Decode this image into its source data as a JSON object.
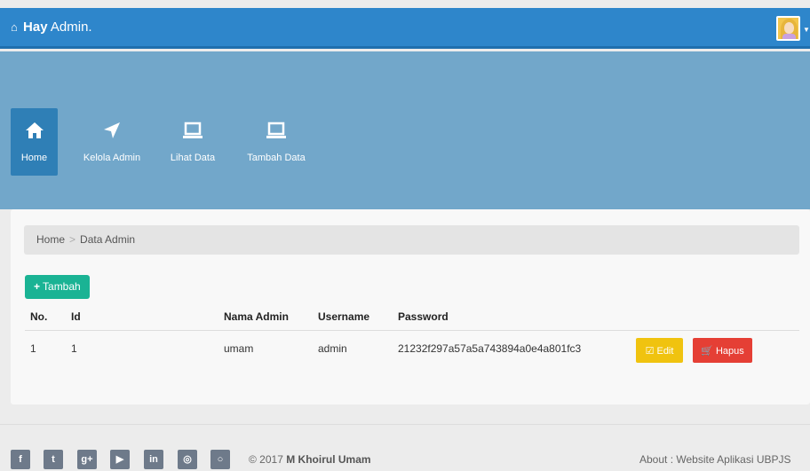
{
  "header": {
    "home_glyph": "⌂",
    "greeting": "Hay",
    "title": " Admin."
  },
  "nav": [
    {
      "label": "Home",
      "icon": "home-icon"
    },
    {
      "label": "Kelola Admin",
      "icon": "send-icon"
    },
    {
      "label": "Lihat Data",
      "icon": "laptop-icon"
    },
    {
      "label": "Tambah Data",
      "icon": "laptop-icon"
    }
  ],
  "breadcrumb": {
    "home": "Home",
    "separator": ">",
    "current": "Data Admin"
  },
  "add_button": {
    "plus": "+",
    "label": "Tambah"
  },
  "table": {
    "headers": [
      "No.",
      "Id",
      "Nama Admin",
      "Username",
      "Password"
    ],
    "rows": [
      {
        "no": "1",
        "id": "1",
        "nama": "umam",
        "username": "admin",
        "password": "21232f297a57a5a743894a0e4a801fc3"
      }
    ],
    "edit_label": "☑ Edit",
    "delete_label": "🛒 Hapus"
  },
  "footer": {
    "social": [
      {
        "glyph": "f",
        "icon": "facebook-icon"
      },
      {
        "glyph": "t",
        "icon": "twitter-icon"
      },
      {
        "glyph": "g+",
        "icon": "google-plus-icon"
      },
      {
        "glyph": "▶",
        "icon": "youtube-icon"
      },
      {
        "glyph": "in",
        "icon": "linkedin-icon"
      },
      {
        "glyph": "◎",
        "icon": "instagram-icon"
      },
      {
        "glyph": "○",
        "icon": "github-icon"
      }
    ],
    "copyright_prefix": "© 2017 ",
    "author": "M Khoirul Umam",
    "about": "About : Website Aplikasi UBPJS"
  },
  "colors": {
    "topbar": "#2e86cb",
    "hero": "#72a7ca",
    "tambah": "#1ab394",
    "edit": "#f0c30f",
    "hapus": "#e53f35"
  }
}
